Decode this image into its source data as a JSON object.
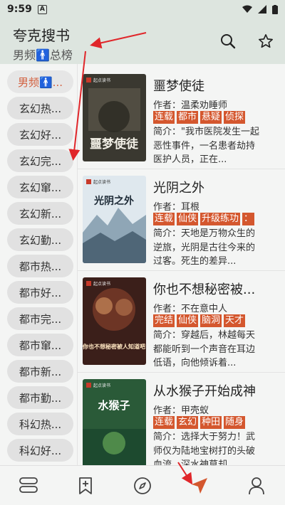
{
  "status_bar": {
    "time": "9:59",
    "notification_badge": "A"
  },
  "header": {
    "title": "夸克搜书",
    "subtitle": "男频🚹总榜"
  },
  "sidebar": {
    "items": [
      {
        "label": "男频🚹..."
      },
      {
        "label": "玄幻热..."
      },
      {
        "label": "玄幻好..."
      },
      {
        "label": "玄幻完..."
      },
      {
        "label": "玄幻窜..."
      },
      {
        "label": "玄幻新..."
      },
      {
        "label": "玄幻勤..."
      },
      {
        "label": "都市热..."
      },
      {
        "label": "都市好..."
      },
      {
        "label": "都市完..."
      },
      {
        "label": "都市窜..."
      },
      {
        "label": "都市新..."
      },
      {
        "label": "都市勤..."
      },
      {
        "label": "科幻热..."
      },
      {
        "label": "科幻好..."
      }
    ]
  },
  "books": [
    {
      "title": "噩梦使徒",
      "author": "作者：温柔劝睡师",
      "tags": [
        "连载",
        "都市",
        "悬疑",
        "侦探"
      ],
      "intro": "简介：\"我市医院发生一起恶性事件，一名患者劫持医护人员，正在...",
      "cover_publisher": "起点读书",
      "cover_title": "噩梦使徒"
    },
    {
      "title": "光阴之外",
      "author": "作者：耳根",
      "tags": [
        "连载",
        "仙侠",
        "升级练功",
        "："
      ],
      "intro": "简介：天地是万物众生的逆旅，光阴是古往今来的过客。死生的差异...",
      "cover_publisher": "起点读书",
      "cover_title": "光阴之外"
    },
    {
      "title": "你也不想秘密被...",
      "author": "作者：不在意中人",
      "tags": [
        "完结",
        "仙侠",
        "脑洞",
        "天才"
      ],
      "intro": "简介：穿越后，林越每天都能听到一个声音在耳边低语，向他倾诉着...",
      "cover_publisher": "起点读书",
      "cover_title": "你也不想秘密被人知道吧"
    },
    {
      "title": "从水猴子开始成神",
      "author": "作者：甲壳蚁",
      "tags": [
        "连载",
        "玄幻",
        "种田",
        "随身"
      ],
      "intro": "简介：选择大于努力！武师仅为陆地宝树打的头破血流，深水神草却...",
      "cover_publisher": "起点读书",
      "cover_title": "水猴子"
    }
  ],
  "colors": {
    "accent": "#d4572e",
    "header_bg": "#dde5df",
    "annotation_arrow": "#e0262a"
  },
  "bottom_nav": [
    "shelf-icon",
    "bookmark-add-icon",
    "compass-icon",
    "send-icon",
    "profile-icon"
  ]
}
